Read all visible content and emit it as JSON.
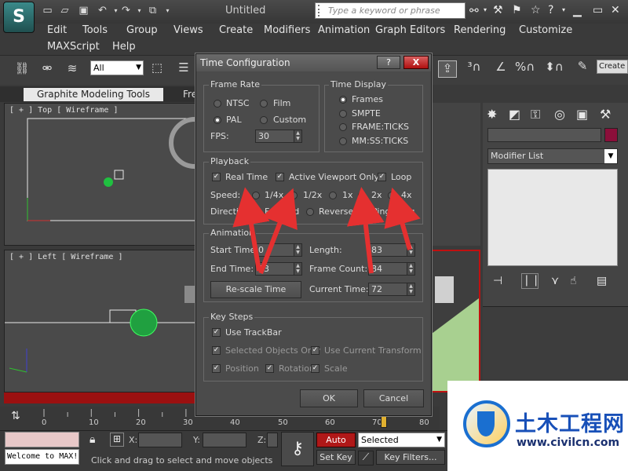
{
  "app": {
    "title": "Untitled",
    "logo_glyph": "S",
    "search_placeholder": "Type a keyword or phrase",
    "menus": [
      "Edit",
      "Tools",
      "Group",
      "Views",
      "Create",
      "Modifiers",
      "Animation",
      "Graph Editors",
      "Rendering",
      "Customize",
      "MAXScript",
      "Help"
    ]
  },
  "toolbar": {
    "selection_filter": "All",
    "create_label": "Create"
  },
  "ribbon": {
    "tab_active": "Graphite Modeling Tools",
    "tab_next": "Fre"
  },
  "viewports": {
    "top": "[ + ] Top [ Wireframe ]",
    "left": "[ + ] Left [ Wireframe ]"
  },
  "command_panel": {
    "modifier_list": "Modifier List",
    "color_accent": "#8b0f3a"
  },
  "timeline": {
    "ticks": [
      "0",
      "10",
      "20",
      "30",
      "40",
      "50",
      "60",
      "70",
      "80"
    ],
    "current_frame_fraction": 0.9
  },
  "status": {
    "maxscript": "Welcome to MAX!",
    "x_label": "X:",
    "y_label": "Y:",
    "z_label": "Z:",
    "hint": "Click and drag to select and move objects",
    "auto_key": "Auto Key",
    "set_key": "Set Key",
    "key_mode": "Selected",
    "key_filters": "Key Filters..."
  },
  "dialog": {
    "title": "Time Configuration",
    "help_label": "?",
    "close_label": "X",
    "frame_rate": {
      "label": "Frame Rate",
      "ntsc": "NTSC",
      "film": "Film",
      "pal": "PAL",
      "custom": "Custom",
      "fps_label": "FPS:",
      "fps_value": "30"
    },
    "time_display": {
      "label": "Time Display",
      "frames": "Frames",
      "smpte": "SMPTE",
      "frame_ticks": "FRAME:TICKS",
      "mmss_ticks": "MM:SS:TICKS"
    },
    "playback": {
      "label": "Playback",
      "real_time": "Real Time",
      "active_viewport_only": "Active Viewport Only",
      "loop": "Loop",
      "speed_label": "Speed:",
      "speed_quarter": "1/4x",
      "speed_half": "1/2x",
      "speed_1x": "1x",
      "speed_2x": "2x",
      "speed_4x": "4x",
      "direction_label": "Direction:",
      "forward": "Forward",
      "reverse": "Reverse",
      "ping_pong": "Ping-Pong"
    },
    "animation": {
      "label": "Animation",
      "start_time_label": "Start Time:",
      "start_time": "0",
      "end_time_label": "End Time:",
      "end_time": "83",
      "length_label": "Length:",
      "length": "83",
      "frame_count_label": "Frame Count:",
      "frame_count": "84",
      "rescale": "Re-scale Time",
      "current_time_label": "Current Time:",
      "current_time": "72"
    },
    "key_steps": {
      "label": "Key Steps",
      "use_trackbar": "Use TrackBar",
      "selected_objects_only": "Selected Objects Only",
      "use_current_transform": "Use Current Transform",
      "position": "Position",
      "rotation": "Rotation",
      "scale": "Scale"
    },
    "ok": "OK",
    "cancel": "Cancel"
  },
  "watermark": {
    "text": "土木工程网",
    "url": "www.civilcn.com"
  }
}
